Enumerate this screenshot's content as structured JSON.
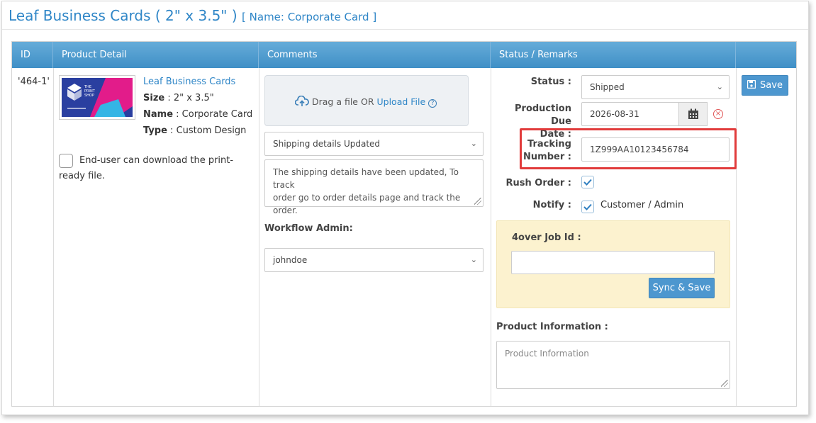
{
  "header": {
    "title": "Leaf Business Cards ( 2\" x 3.5\" )",
    "subtitle": "[ Name: Corporate Card ]"
  },
  "table": {
    "columns": [
      "ID",
      "Product Detail",
      "Comments",
      "Status / Remarks"
    ]
  },
  "row": {
    "id": "'464-1'",
    "product": {
      "name_link": "Leaf Business Cards",
      "size_label": "Size",
      "size_value": " : 2\" x 3.5\"",
      "name_label": "Name",
      "name_value": " : Corporate Card",
      "type_label": "Type",
      "type_value": " : Custom Design",
      "thumbnail_brand_line1": "THE",
      "thumbnail_brand_line2": "PRINT",
      "thumbnail_brand_line3": "SHOP",
      "download_checkbox_line1": "End-user can download the print-",
      "download_checkbox_line2": "ready file.",
      "download_checked": false
    },
    "comments": {
      "dropzone_text": "Drag a file OR",
      "dropzone_link": "Upload File",
      "comment_select": "Shipping details Updated",
      "comment_text_line1": "The shipping details have been updated, To track",
      "comment_text_line2": "order go to order details page and track the order.",
      "workflow_admin_label": "Workflow Admin:",
      "workflow_admin_value": "johndoe"
    },
    "status": {
      "status_label": "Status :",
      "status_value": "Shipped",
      "due_label_line1": "Production Due",
      "due_label_line2": "Date :",
      "due_value": "2026-08-31",
      "tracking_label_line1": "Tracking",
      "tracking_label_line2": "Number :",
      "tracking_value": "1Z999AA10123456784",
      "rush_label": "Rush Order :",
      "rush_checked": true,
      "notify_label": "Notify :",
      "notify_checked": true,
      "notify_value": "Customer / Admin",
      "job_id_label": "4over Job Id :",
      "job_id_value": "",
      "sync_button": "Sync & Save",
      "product_info_label": "Product Information :",
      "product_info_placeholder": "Product Information"
    },
    "save_button": "Save"
  },
  "colors": {
    "accent": "#2f86c7",
    "header_bar": "#4d9bd1",
    "highlight_border": "#e13b3b",
    "yellow_panel": "#fcf2cf"
  }
}
